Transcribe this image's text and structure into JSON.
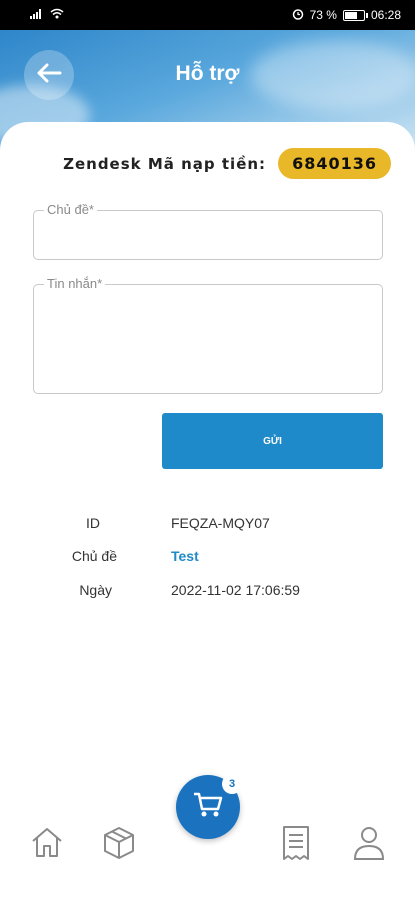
{
  "status_bar": {
    "signal_icon": "signal-icon",
    "wifi_icon": "wifi-icon",
    "alarm_icon": "alarm-icon",
    "battery_percent": "73 %",
    "battery_level": 0.73,
    "time": "06:28"
  },
  "header": {
    "title": "Hỗ trợ",
    "back_icon": "arrow-left-icon"
  },
  "zendesk": {
    "label": "Zendesk Mã nạp tiền:",
    "code": "6840136"
  },
  "form": {
    "subject_label": "Chủ đề*",
    "message_label": "Tin nhắn*",
    "send_label": "GỬI"
  },
  "ticket": {
    "rows": [
      {
        "key": "ID",
        "value": "FEQZA-MQY07"
      },
      {
        "key": "Chủ đề",
        "value": "Test"
      },
      {
        "key": "Ngày",
        "value": "2022-11-02 17:06:59"
      }
    ]
  },
  "bottom_nav": {
    "items": [
      "home-icon",
      "box-icon",
      "receipt-icon",
      "user-icon"
    ],
    "cart_icon": "cart-icon",
    "cart_count": "3"
  },
  "colors": {
    "accent": "#1f8ac9",
    "badge": "#e8b828",
    "fab": "#1b73c0"
  }
}
